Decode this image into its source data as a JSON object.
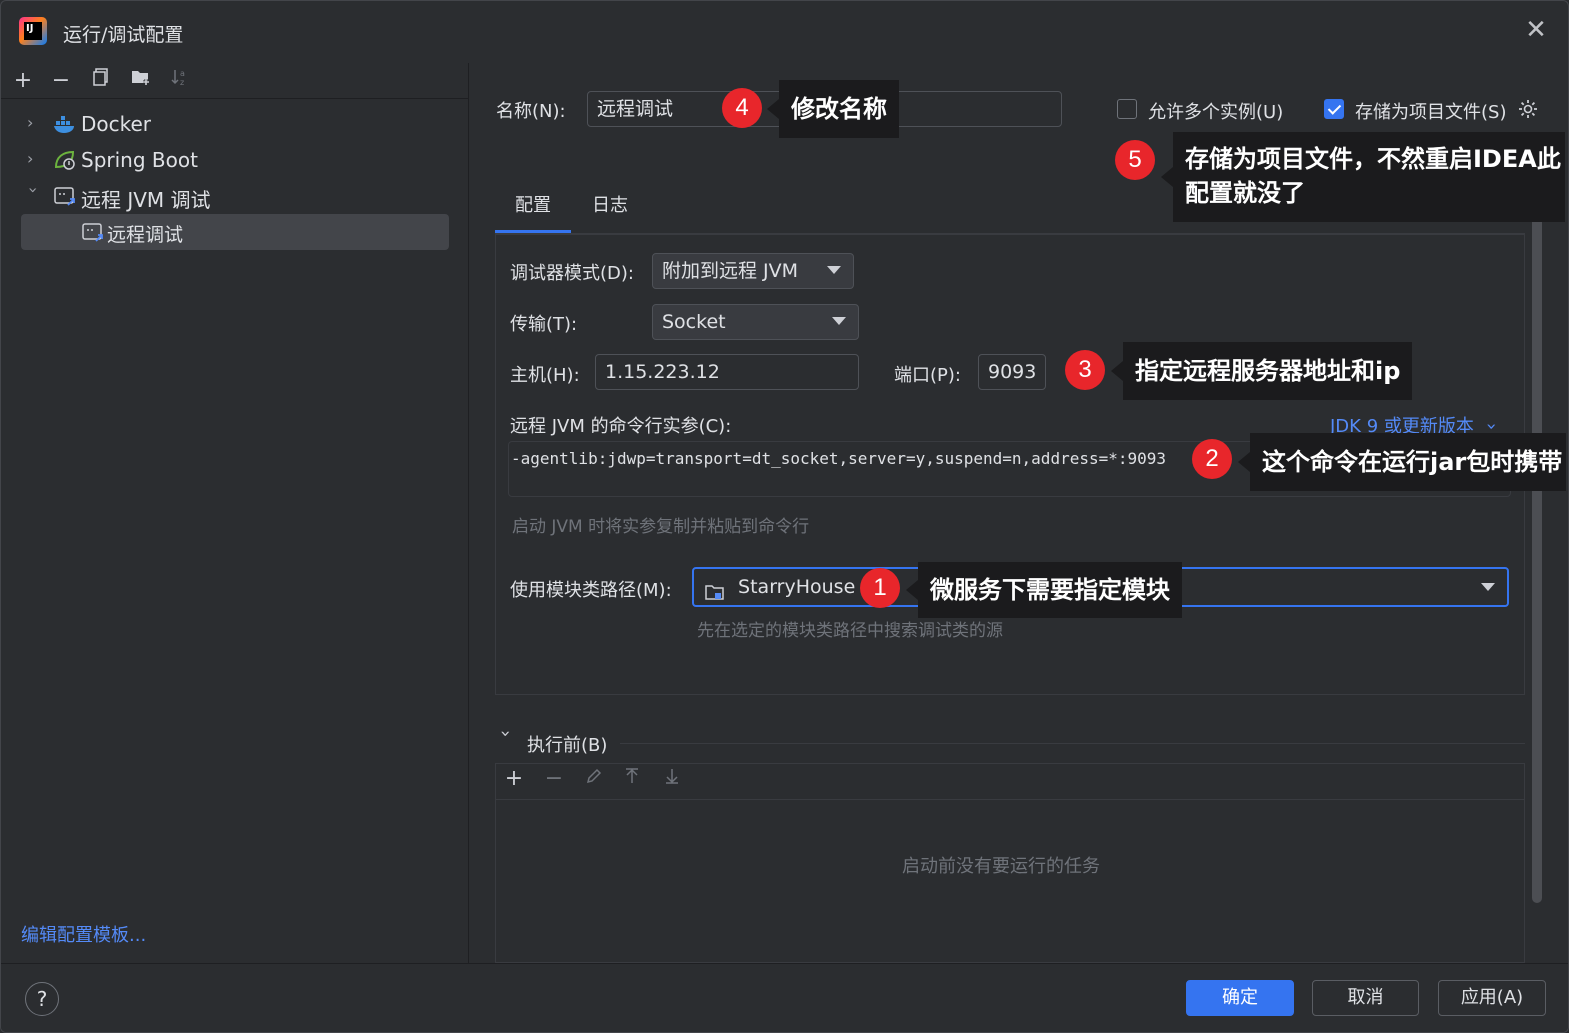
{
  "window": {
    "title": "运行/调试配置"
  },
  "left_panel": {
    "tree": [
      {
        "label": "Docker",
        "icon": "docker-icon",
        "expanded": false
      },
      {
        "label": "Spring Boot",
        "icon": "spring-boot-icon",
        "expanded": false
      },
      {
        "label": "远程 JVM 调试",
        "icon": "remote-jvm-icon",
        "expanded": true
      },
      {
        "label": "远程调试",
        "icon": "remote-jvm-icon",
        "selected": true
      }
    ],
    "edit_templates_link": "编辑配置模板..."
  },
  "form": {
    "name_label": "名称(N):",
    "name_value": "远程调试",
    "allow_multiple_label": "允许多个实例(U)",
    "allow_multiple_checked": false,
    "store_as_project_label": "存储为项目文件(S)",
    "store_as_project_checked": true,
    "tabs": [
      "配置",
      "日志"
    ],
    "active_tab": "配置",
    "debugger_mode_label": "调试器模式(D):",
    "debugger_mode_value": "附加到远程 JVM",
    "transport_label": "传输(T):",
    "transport_value": "Socket",
    "host_label": "主机(H):",
    "host_value": "1.15.223.12",
    "port_label": "端口(P):",
    "port_value": "9093",
    "cmd_args_label": "远程 JVM 的命令行实参(C):",
    "jdk_version_link": "JDK 9 或更新版本",
    "cmd_args_value": "-agentlib:jdwp=transport=dt_socket,server=y,suspend=n,address=*:9093",
    "cmd_args_hint": "启动 JVM 时将实参复制并粘贴到命令行",
    "module_classpath_label": "使用模块类路径(M):",
    "module_classpath_value": "StarryHouse",
    "module_classpath_hint": "先在选定的模块类路径中搜索调试类的源",
    "before_launch_label": "执行前(B)",
    "before_launch_empty": "启动前没有要运行的任务"
  },
  "annotations": [
    {
      "number": "1",
      "text": "微服务下需要指定模块"
    },
    {
      "number": "2",
      "text": "这个命令在运行jar包时携带"
    },
    {
      "number": "3",
      "text": "指定远程服务器地址和ip"
    },
    {
      "number": "4",
      "text": "修改名称"
    },
    {
      "number": "5",
      "text_line1": "存储为项目文件，不然重启IDEA此",
      "text_line2": "配置就没了"
    }
  ],
  "buttons": {
    "ok": "确定",
    "cancel": "取消",
    "apply": "应用(A)",
    "help": "?"
  },
  "colors": {
    "background": "#2b2d30",
    "accent": "#3574f0",
    "link": "#548af7",
    "badge": "#e8262b",
    "callout": "#1b1b1d"
  }
}
